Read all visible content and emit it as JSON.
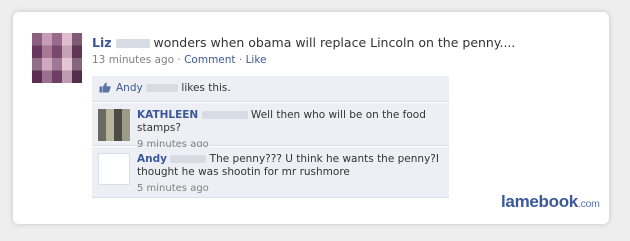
{
  "post": {
    "author": "Liz",
    "status_text": "wonders when obama will replace Lincoln on the penny....",
    "timestamp": "13 minutes ago",
    "separator": "·",
    "comment_label": "Comment",
    "like_label": "Like"
  },
  "likes": {
    "name": "Andy",
    "suffix": "likes this.",
    "icon": "thumbs-up-icon"
  },
  "comments": [
    {
      "author": "KATHLEEN",
      "text": "Well then who will be on the food stamps?",
      "timestamp": "9 minutes ago"
    },
    {
      "author": "Andy",
      "text": "The penny??? U think he wants the penny?I thought he was shootin for mr rushmore",
      "timestamp": "5 minutes ago"
    }
  ],
  "watermark": {
    "brand": "lamebook",
    "domain": ".com"
  },
  "colors": {
    "link": "#3b5998",
    "comment_bg": "#edeff4",
    "meta": "#808080"
  }
}
